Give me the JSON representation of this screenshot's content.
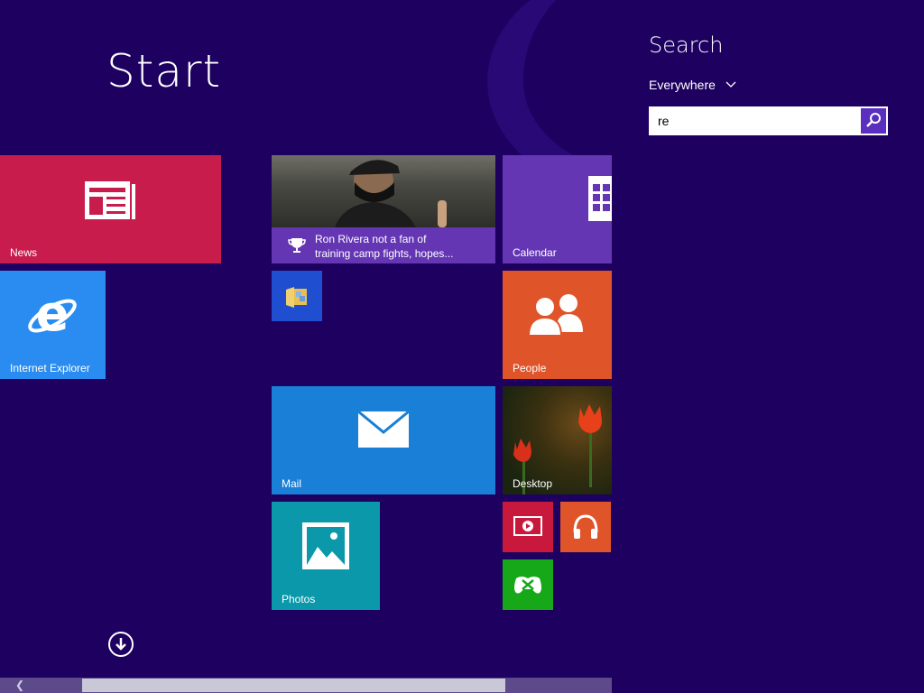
{
  "start": {
    "title": "Start"
  },
  "tiles": {
    "news": {
      "label": "News"
    },
    "ie": {
      "label": "Internet Explorer"
    },
    "sports": {
      "headline_line1": "Ron Rivera not a fan of",
      "headline_line2": "training camp fights, hopes..."
    },
    "mail": {
      "label": "Mail"
    },
    "photos": {
      "label": "Photos"
    },
    "calendar": {
      "label": "Calendar"
    },
    "people": {
      "label": "People"
    },
    "desktop": {
      "label": "Desktop"
    }
  },
  "search": {
    "title": "Search",
    "scope": "Everywhere",
    "query": "re"
  },
  "colors": {
    "background": "#1d0060",
    "news": "#c81c4c",
    "ie": "#2a8cf0",
    "mail": "#1a7fd6",
    "photos": "#0a98aa",
    "calendar": "#6436b4",
    "people": "#e0542a",
    "video": "#c8183c",
    "games": "#16a818"
  },
  "icons": [
    "news-icon",
    "internet-explorer-icon",
    "trophy-icon",
    "file-explorer-icon",
    "mail-icon",
    "photos-icon",
    "calendar-icon",
    "people-icon",
    "video-icon",
    "music-icon",
    "games-icon",
    "all-apps-arrow-icon",
    "search-icon",
    "chevron-down-icon"
  ]
}
